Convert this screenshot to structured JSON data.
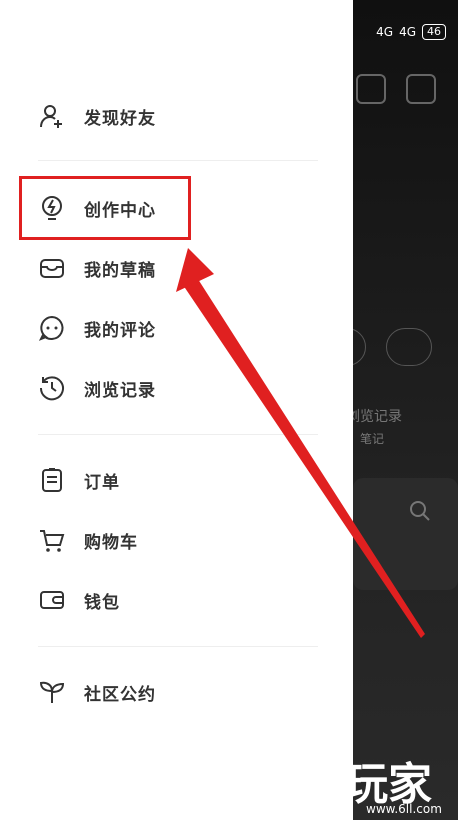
{
  "status_bar": {
    "signal1": "4G",
    "signal2": "4G",
    "battery": "46"
  },
  "menu_groups": [
    [
      {
        "label": "发现好友",
        "icon": "add-friend-icon"
      }
    ],
    [
      {
        "label": "创作中心",
        "icon": "lightbulb-icon"
      },
      {
        "label": "我的草稿",
        "icon": "inbox-icon"
      },
      {
        "label": "我的评论",
        "icon": "comment-icon"
      },
      {
        "label": "浏览记录",
        "icon": "history-icon"
      }
    ],
    [
      {
        "label": "订单",
        "icon": "clipboard-icon"
      },
      {
        "label": "购物车",
        "icon": "cart-icon"
      },
      {
        "label": "钱包",
        "icon": "wallet-icon"
      }
    ],
    [
      {
        "label": "社区公约",
        "icon": "sprout-icon"
      }
    ]
  ],
  "background_text": {
    "history": "浏览记录",
    "notes": "笔记"
  },
  "watermark": {
    "text": "大玩家",
    "url": "www.6ll.com"
  },
  "colors": {
    "highlight": "#e02020",
    "arrow": "#e02020"
  }
}
